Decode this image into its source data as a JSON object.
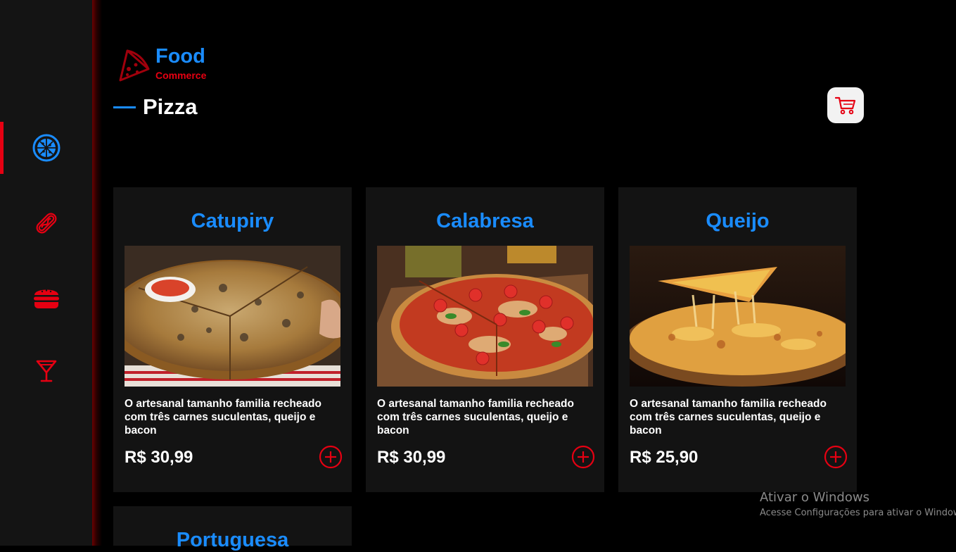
{
  "brand": {
    "title": "Food",
    "subtitle": "Commerce",
    "colors": {
      "accent_blue": "#1a8cff",
      "accent_red": "#e60012",
      "card_bg": "#131313"
    }
  },
  "sidebar": {
    "items": [
      {
        "icon": "pizza-icon",
        "active": true
      },
      {
        "icon": "hotdog-icon",
        "active": false
      },
      {
        "icon": "burger-icon",
        "active": false
      },
      {
        "icon": "cocktail-icon",
        "active": false
      }
    ]
  },
  "page": {
    "title": "Pizza"
  },
  "cart": {
    "icon": "cart-icon"
  },
  "products": [
    {
      "name": "Catupiry",
      "description": "O artesanal tamanho familia recheado com três carnes suculentas, queijo e bacon",
      "price": "R$ 30,99"
    },
    {
      "name": "Calabresa",
      "description": "O artesanal tamanho familia recheado com três carnes suculentas, queijo e bacon",
      "price": "R$ 30,99"
    },
    {
      "name": "Queijo",
      "description": "O artesanal tamanho familia recheado com três carnes suculentas, queijo e bacon",
      "price": "R$ 25,90"
    },
    {
      "name": "Portuguesa"
    }
  ],
  "watermark": {
    "title": "Ativar o Windows",
    "subtitle": "Acesse Configurações para ativar o Windows."
  }
}
